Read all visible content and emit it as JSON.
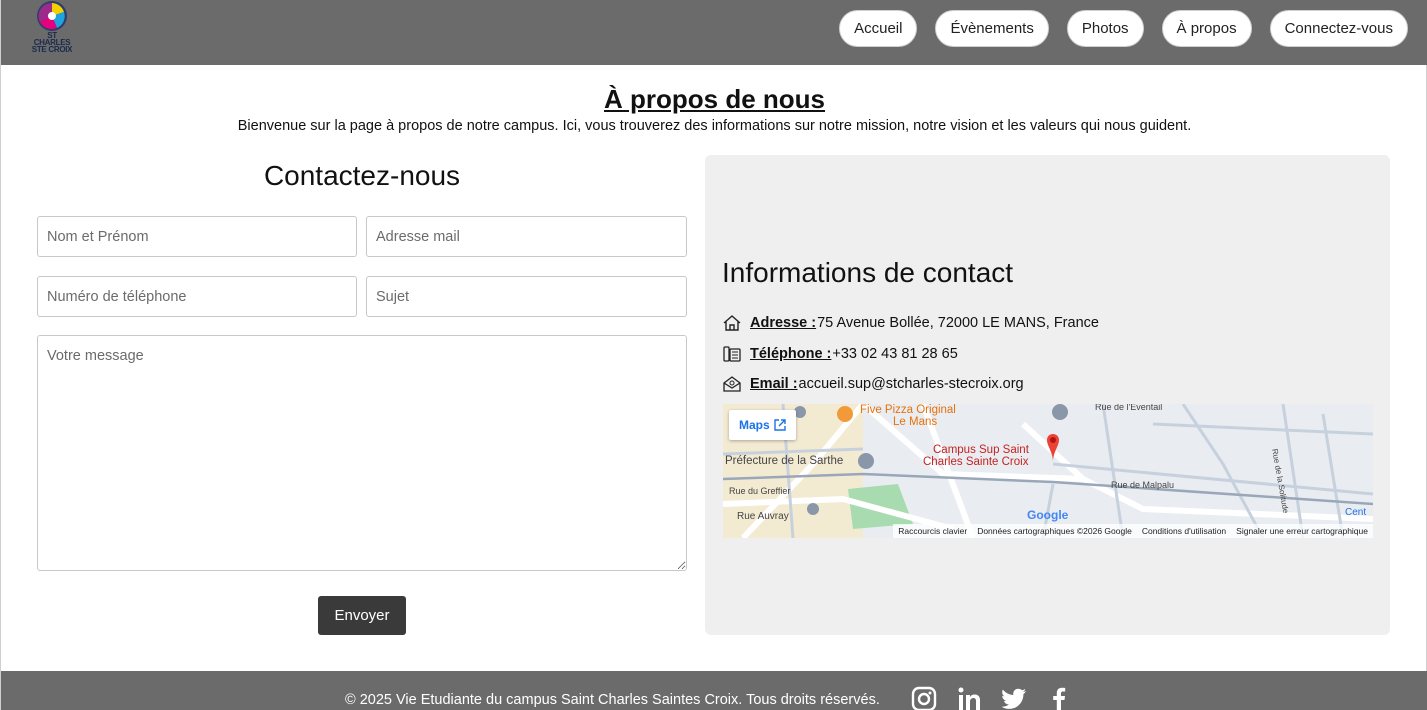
{
  "header": {
    "logo_text_line1": "ST CHARLES",
    "logo_text_line2": "STE CROIX",
    "nav": [
      "Accueil",
      "Évènements",
      "Photos",
      "À propos",
      "Connectez-vous"
    ]
  },
  "main": {
    "title": "À propos de nous",
    "intro": "Bienvenue sur la page à propos de notre campus. Ici, vous trouverez des informations sur notre mission, notre vision et les valeurs qui nous guident."
  },
  "form": {
    "title": "Contactez-nous",
    "name_placeholder": "Nom et Prénom",
    "email_placeholder": "Adresse mail",
    "phone_placeholder": "Numéro de téléphone",
    "subject_placeholder": "Sujet",
    "message_placeholder": "Votre message",
    "submit_label": "Envoyer"
  },
  "contact": {
    "title": "Informations de contact",
    "address_label": "Adresse :",
    "address_value": "75 Avenue Bollée, 72000 LE MANS, France",
    "phone_label": "Téléphone :",
    "phone_value": "+33 02 43 81 28 65",
    "email_label": "Email :",
    "email_value": "accueil.sup@stcharles-stecroix.org"
  },
  "map": {
    "maps_button": "Maps",
    "labels": {
      "pizza": "Five Pizza Original",
      "pizza_city": "Le Mans",
      "campus_line1": "Campus Sup Saint",
      "campus_line2": "Charles Sainte Croix",
      "prefecture": "Préfecture de la Sarthe",
      "greffier": "Rue du Greffier",
      "auvray": "Rue Auvray",
      "malpalu": "Rue de Malpalu",
      "eventail": "Rue de l'Éventail",
      "solitude": "Rue de la Solitude",
      "cent": "Cent"
    },
    "footer": [
      "Raccourcis clavier",
      "Données cartographiques ©2026 Google",
      "Conditions d'utilisation",
      "Signaler une erreur cartographique"
    ],
    "google": "Google"
  },
  "footer": {
    "copyright": "© 2025 Vie Etudiante du campus Saint Charles Saintes Croix. Tous droits réservés."
  }
}
